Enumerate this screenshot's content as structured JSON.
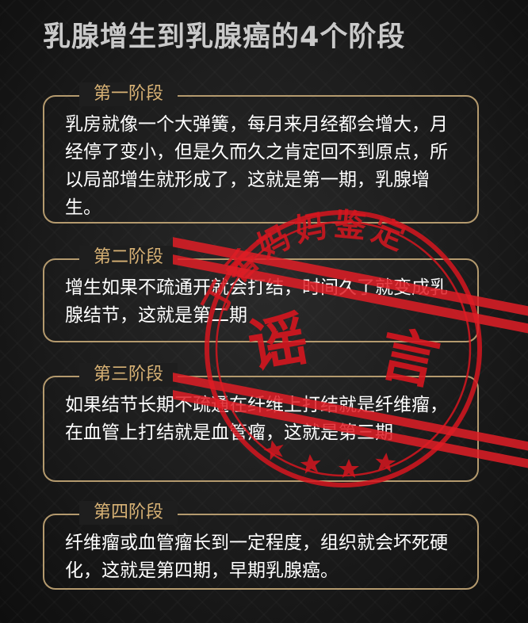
{
  "title": "乳腺增生到乳腺癌的4个阶段",
  "stages": [
    {
      "label": "第一阶段",
      "text": "乳房就像一个大弹簧，每月来月经都会增大，月经停了变小，但是久而久之肯定回不到原点，所以局部增生就形成了，这就是第一期，乳腺增生。"
    },
    {
      "label": "第二阶段",
      "text": "增生如果不疏通开就会打结，时间久了就变成乳腺结节，这就是第二期"
    },
    {
      "label": "第三阶段",
      "text": "如果结节长期不疏通在纤维上打结就是纤维瘤，在血管上打结就是血管瘤，这就是第三期"
    },
    {
      "label": "第四阶段",
      "text": "纤维瘤或血管瘤长到一定程度，组织就会坏死硬化，这就是第四期，早期乳腺癌。"
    }
  ],
  "stamp": {
    "org_text": "丁香妈妈鉴定",
    "verdict_left": "谣",
    "verdict_right": "言",
    "color": "#d6161f"
  },
  "colors": {
    "accent": "#d8b275",
    "border": "#b49a6e",
    "title": "#c9c9c9",
    "text": "#ffffff"
  }
}
